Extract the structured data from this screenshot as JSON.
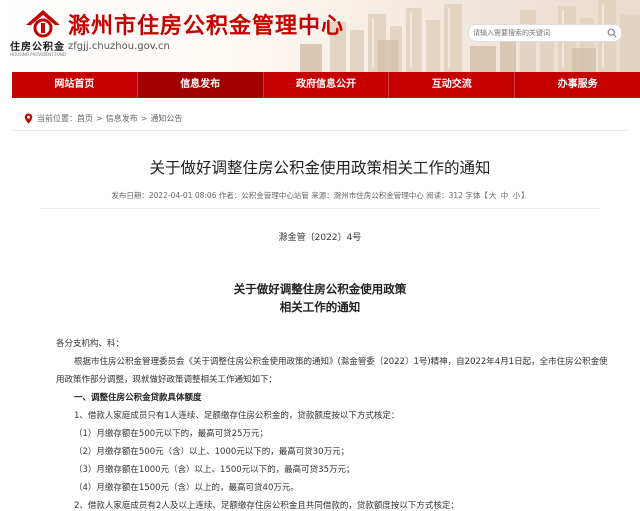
{
  "header": {
    "site_title": "滁州市住房公积金管理中心",
    "brand_name": "住房公积金",
    "brand_en": "HOUSING PROVIDENT FUND",
    "url": "zfgjj.chuzhou.gov.cn",
    "search_placeholder": "请输入需要搜索的关键词"
  },
  "nav": [
    {
      "label": "网站首页"
    },
    {
      "label": "信息发布"
    },
    {
      "label": "政府信息公开"
    },
    {
      "label": "互动交流"
    },
    {
      "label": "办事服务"
    }
  ],
  "breadcrumb": {
    "prefix": "当前位置：",
    "items": [
      "首页",
      "信息发布",
      "通知公告"
    ],
    "separator": ">"
  },
  "article": {
    "title": "关于做好调整住房公积金使用政策相关工作的通知",
    "meta": "发布日期：2022-04-01 08:06  作者：公积金管理中心站管  来源：滁州市住房公积金管理中心  阅读：312  字体【",
    "font_sizes": [
      "大",
      "中",
      "小"
    ],
    "meta_end": "】",
    "doc_no": "滁金管〔2022〕4号",
    "doc_title_line1": "关于做好调整住房公积金使用政策",
    "doc_title_line2": "相关工作的通知",
    "paragraphs": [
      {
        "text": "各分支机构、科：",
        "bold": false
      },
      {
        "text": "根据市住房公积金管理委员会《关于调整住房公积金使用政策的通知》(滁金管委〔2022〕1号)精神，自2022年4月1日起，全市住房公积金使",
        "bold": false
      },
      {
        "text": "用政策作部分调整，现就做好政策调整相关工作通知如下：",
        "bold": false
      },
      {
        "text": "一、调整住房公积金贷款具体额度",
        "bold": true
      },
      {
        "text": "1、借款人家庭成员只有1人连续、足额缴存住房公积金的，贷款额度按以下方式核定：",
        "bold": false
      },
      {
        "text": "（1）月缴存额在500元以下的，最高可贷25万元；",
        "bold": false
      },
      {
        "text": "（2）月缴存额在500元（含）以上、1000元以下的，最高可贷30万元；",
        "bold": false
      },
      {
        "text": "（3）月缴存额在1000元（含）以上、1500元以下的，最高可贷35万元；",
        "bold": false
      },
      {
        "text": "（4）月缴存额在1500元（含）以上的，最高可贷40万元。",
        "bold": false
      },
      {
        "text": "2、借款人家庭成员有2人及以上连续、足额缴存住房公积金且共同借款的，贷款额度按以下方式核定：",
        "bold": false
      }
    ]
  },
  "colors": {
    "primary_red": "#c40000",
    "nav_active": "#a10000"
  }
}
